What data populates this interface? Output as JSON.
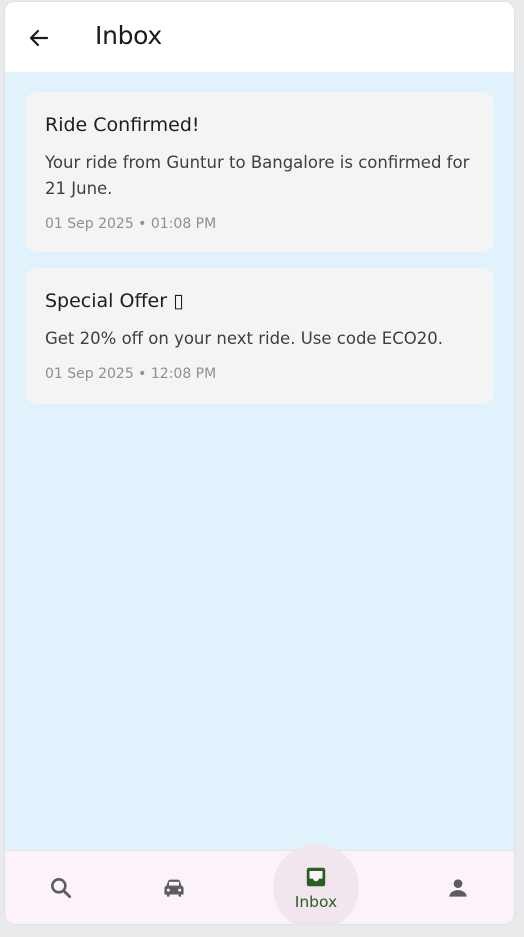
{
  "header": {
    "title": "Inbox"
  },
  "messages": [
    {
      "title": "Ride Confirmed!",
      "body": "Your ride from Guntur to Bangalore is confirmed for 21 June.",
      "time": "01 Sep 2025 • 01:08 PM"
    },
    {
      "title": "Special Offer ▯",
      "body": "Get 20% off on your next ride. Use code ECO20.",
      "time": "01 Sep 2025 • 12:08 PM"
    }
  ],
  "bottom_nav": {
    "items": [
      {
        "icon": "search-icon",
        "label": ""
      },
      {
        "icon": "car-icon",
        "label": ""
      },
      {
        "icon": "inbox-icon",
        "label": "Inbox",
        "active": true
      },
      {
        "icon": "person-icon",
        "label": ""
      }
    ]
  },
  "colors": {
    "background": "#e0f3fc",
    "card": "#f4f4f4",
    "nav_background": "#fcf2f9",
    "active_nav": "#2b5f1f"
  }
}
